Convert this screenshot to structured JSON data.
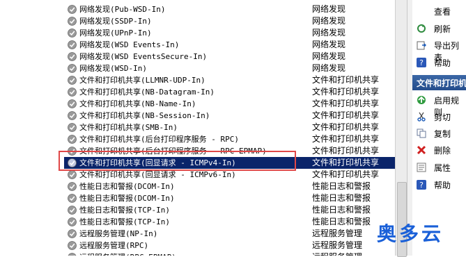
{
  "rules": [
    {
      "name": "网络发现(Pub-WSD-In)",
      "group": "网络发现",
      "selected": false
    },
    {
      "name": "网络发现(SSDP-In)",
      "group": "网络发现",
      "selected": false
    },
    {
      "name": "网络发现(UPnP-In)",
      "group": "网络发现",
      "selected": false
    },
    {
      "name": "网络发现(WSD Events-In)",
      "group": "网络发现",
      "selected": false
    },
    {
      "name": "网络发现(WSD EventsSecure-In)",
      "group": "网络发现",
      "selected": false
    },
    {
      "name": "网络发现(WSD-In)",
      "group": "网络发现",
      "selected": false
    },
    {
      "name": "文件和打印机共享(LLMNR-UDP-In)",
      "group": "文件和打印机共享",
      "selected": false
    },
    {
      "name": "文件和打印机共享(NB-Datagram-In)",
      "group": "文件和打印机共享",
      "selected": false
    },
    {
      "name": "文件和打印机共享(NB-Name-In)",
      "group": "文件和打印机共享",
      "selected": false
    },
    {
      "name": "文件和打印机共享(NB-Session-In)",
      "group": "文件和打印机共享",
      "selected": false
    },
    {
      "name": "文件和打印机共享(SMB-In)",
      "group": "文件和打印机共享",
      "selected": false
    },
    {
      "name": "文件和打印机共享(后台打印程序服务 - RPC)",
      "group": "文件和打印机共享",
      "selected": false
    },
    {
      "name": "文件和打印机共享(后台打印程序服务 - RPC-EPMAP)",
      "group": "文件和打印机共享",
      "selected": false
    },
    {
      "name": "文件和打印机共享(回显请求 - ICMPv4-In)",
      "group": "文件和打印机共享",
      "selected": true
    },
    {
      "name": "文件和打印机共享(回显请求 - ICMPv6-In)",
      "group": "文件和打印机共享",
      "selected": false
    },
    {
      "name": "性能日志和警报(DCOM-In)",
      "group": "性能日志和警报",
      "selected": false
    },
    {
      "name": "性能日志和警报(DCOM-In)",
      "group": "性能日志和警报",
      "selected": false
    },
    {
      "name": "性能日志和警报(TCP-In)",
      "group": "性能日志和警报",
      "selected": false
    },
    {
      "name": "性能日志和警报(TCP-In)",
      "group": "性能日志和警报",
      "selected": false
    },
    {
      "name": "远程服务管理(NP-In)",
      "group": "远程服务管理",
      "selected": false
    },
    {
      "name": "远程服务管理(RPC)",
      "group": "远程服务管理",
      "selected": false
    },
    {
      "name": "远程服务管理(RPC-EPMAP)",
      "group": "远程服务管理",
      "selected": false
    }
  ],
  "actions_top": [
    {
      "label": "查看",
      "icon": "view-icon"
    },
    {
      "label": "刷新",
      "icon": "refresh-icon"
    },
    {
      "label": "导出列表",
      "icon": "export-list-icon"
    },
    {
      "label": "帮助",
      "icon": "help-icon"
    }
  ],
  "section_title": "文件和打印机共享",
  "actions_section": [
    {
      "label": "启用规则",
      "icon": "enable-rule-icon"
    },
    {
      "label": "剪切",
      "icon": "cut-icon"
    },
    {
      "label": "复制",
      "icon": "copy-icon"
    },
    {
      "label": "删除",
      "icon": "delete-icon"
    },
    {
      "label": "属性",
      "icon": "properties-icon"
    },
    {
      "label": "帮助",
      "icon": "help-icon"
    }
  ],
  "watermark": "奥多云",
  "colors": {
    "selection": "#0a246a",
    "highlight_box": "#e04848",
    "watermark": "#1a60d8"
  }
}
